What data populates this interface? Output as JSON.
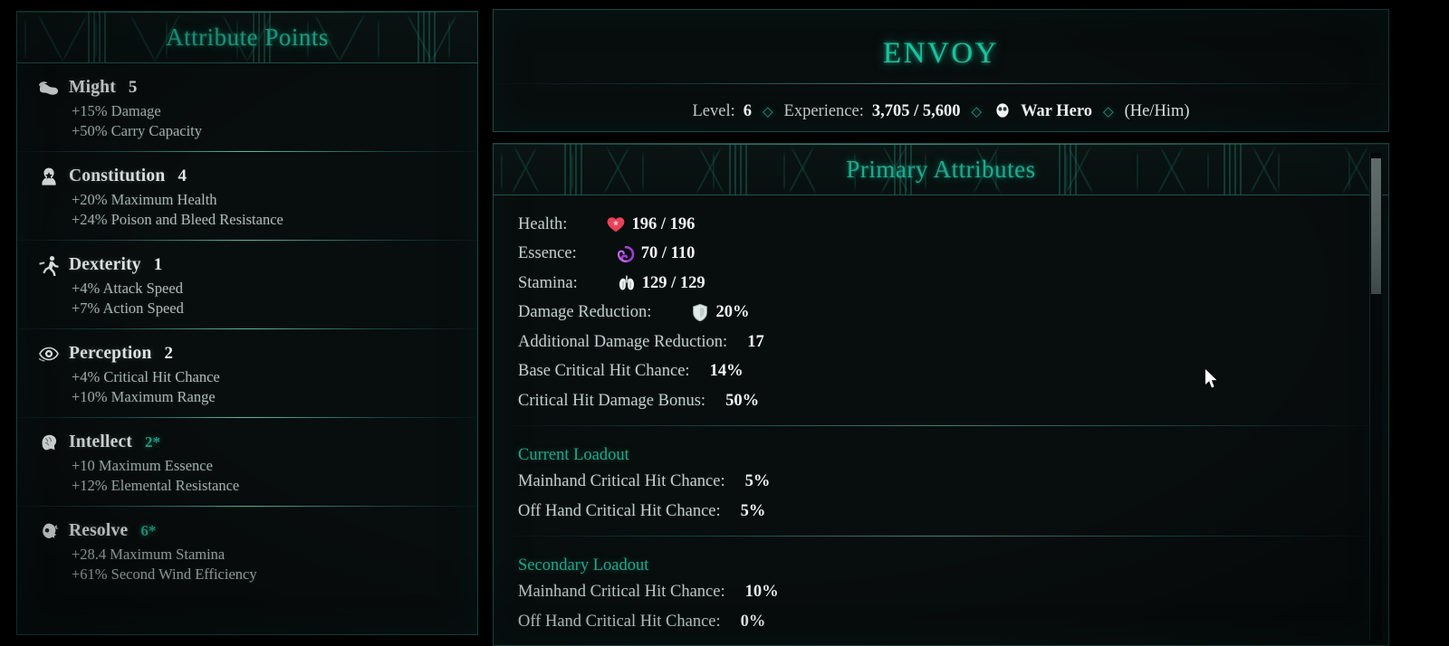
{
  "attribute_panel": {
    "title": "Attribute Points",
    "attributes": [
      {
        "icon": "bicep-icon",
        "name": "Might",
        "value": "5",
        "buffed": false,
        "bonuses": [
          "+15% Damage",
          "+50% Carry Capacity"
        ]
      },
      {
        "icon": "constitution-icon",
        "name": "Constitution",
        "value": "4",
        "buffed": false,
        "bonuses": [
          "+20% Maximum Health",
          "+24% Poison and Bleed Resistance"
        ]
      },
      {
        "icon": "runner-icon",
        "name": "Dexterity",
        "value": "1",
        "buffed": false,
        "bonuses": [
          "+4% Attack Speed",
          "+7% Action Speed"
        ]
      },
      {
        "icon": "eye-icon",
        "name": "Perception",
        "value": "2",
        "buffed": false,
        "bonuses": [
          "+4% Critical Hit Chance",
          "+10% Maximum Range"
        ]
      },
      {
        "icon": "brain-icon",
        "name": "Intellect",
        "value": "2*",
        "buffed": true,
        "bonuses": [
          "+10 Maximum Essence",
          "+12% Elemental Resistance"
        ]
      },
      {
        "icon": "resolve-icon",
        "name": "Resolve",
        "value": "6*",
        "buffed": true,
        "bonuses": [
          "+28.4 Maximum Stamina",
          "+61% Second Wind Efficiency"
        ]
      }
    ]
  },
  "character_header": {
    "name": "ENVOY",
    "level_label": "Level:",
    "level_value": "6",
    "experience_label": "Experience:",
    "experience_value": "3,705 / 5,600",
    "title_icon": "war-hero-medal-icon",
    "title_text": "War Hero",
    "pronouns": "(He/Him)",
    "separator": "◇"
  },
  "primary_attributes": {
    "title": "Primary Attributes",
    "stats": [
      {
        "label": "Health:",
        "icon": "heart-icon",
        "value": "196 / 196"
      },
      {
        "label": "Essence:",
        "icon": "essence-icon",
        "value": "70 / 110"
      },
      {
        "label": "Stamina:",
        "icon": "lungs-icon",
        "value": "129 / 129"
      },
      {
        "label": "Damage Reduction:",
        "icon": "shield-icon",
        "value": "20%"
      },
      {
        "label": "Additional Damage Reduction:",
        "icon": "",
        "value": "17"
      },
      {
        "label": "Base Critical Hit Chance:",
        "icon": "",
        "value": "14%"
      },
      {
        "label": "Critical Hit Damage Bonus:",
        "icon": "",
        "value": "50%"
      }
    ],
    "loadouts": [
      {
        "title": "Current Loadout",
        "rows": [
          {
            "label": "Mainhand Critical Hit Chance:",
            "value": "5%"
          },
          {
            "label": "Off Hand Critical Hit Chance:",
            "value": "5%"
          }
        ]
      },
      {
        "title": "Secondary Loadout",
        "rows": [
          {
            "label": "Mainhand Critical Hit Chance:",
            "value": "10%"
          },
          {
            "label": "Off Hand Critical Hit Chance:",
            "value": "0%"
          }
        ]
      }
    ]
  },
  "colors": {
    "accent_teal": "#1fa98d",
    "title_teal": "#17c39c",
    "text_primary": "#e6ecea",
    "text_secondary": "#aebcb9",
    "health_red": "#e8415a",
    "essence_purple": "#9b3fd4",
    "stamina_white": "#dfe8e6",
    "panel_bg": "#080d0d"
  }
}
